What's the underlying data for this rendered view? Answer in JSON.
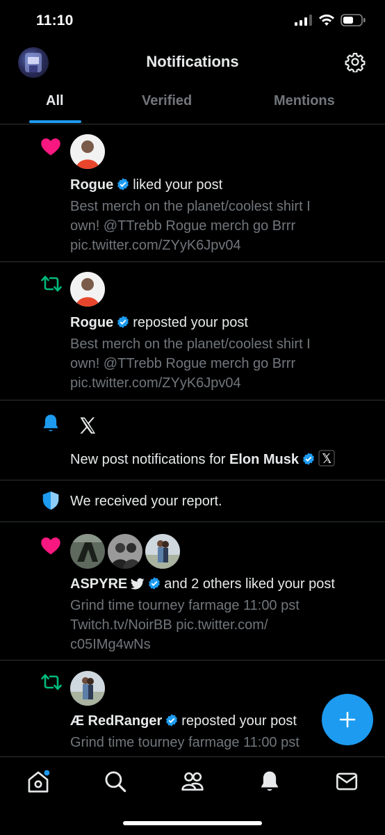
{
  "status_bar": {
    "time": "11:10"
  },
  "header": {
    "title": "Notifications"
  },
  "tabs": [
    {
      "label": "All",
      "active": true
    },
    {
      "label": "Verified",
      "active": false
    },
    {
      "label": "Mentions",
      "active": false
    }
  ],
  "notifications": [
    {
      "type": "like",
      "actor": "Rogue",
      "action": "liked your post",
      "preview_lines": [
        "Best merch on the planet/coolest shirt I",
        "own! @TTrebb Rogue merch go Brrr",
        "pic.twitter.com/ZYyK6Jpv04"
      ]
    },
    {
      "type": "repost",
      "actor": "Rogue",
      "action": "reposted your post",
      "preview_lines": [
        "Best merch on the planet/coolest shirt I",
        "own! @TTrebb Rogue merch go Brrr",
        "pic.twitter.com/ZYyK6Jpv04"
      ]
    },
    {
      "type": "bell",
      "prefix": "New post notifications for",
      "actor": "Elon Musk"
    },
    {
      "type": "report",
      "text": "We received your report."
    },
    {
      "type": "like",
      "actor": "ASPYRE",
      "action": "and 2 others liked your post",
      "preview_lines": [
        "Grind time tourney farmage 11:00 pst",
        "Twitch.tv/NoirBB pic.twitter.com/",
        "c05IMg4wNs"
      ]
    },
    {
      "type": "repost",
      "actor": "Æ RedRanger",
      "action": "reposted your post",
      "preview_lines": [
        "Grind time tourney farmage 11:00 pst"
      ]
    }
  ],
  "colors": {
    "accent": "#1d9bf0",
    "like": "#f91880",
    "repost": "#00ba7c",
    "muted": "#71767b"
  }
}
